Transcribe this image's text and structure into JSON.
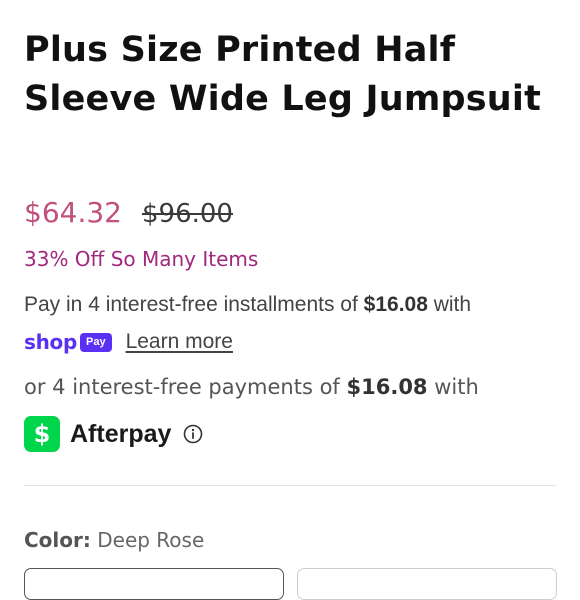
{
  "product": {
    "title": "Plus Size Printed Half Sleeve Wide Leg Jumpsuit",
    "price_sale": "$64.32",
    "price_compare": "$96.00",
    "promo": "33% Off So Many Items"
  },
  "shop_pay": {
    "prefix": "Pay in 4 interest-free installments of ",
    "amount": "$16.08",
    "suffix": " with",
    "logo_word": "shop",
    "logo_badge": "Pay",
    "learn_more": "Learn more"
  },
  "afterpay": {
    "prefix": "or 4 interest-free payments of ",
    "amount": "$16.08",
    "suffix": " with",
    "icon_symbol": "$",
    "name": "Afterpay"
  },
  "options": {
    "color_label": "Color:",
    "color_value": "Deep Rose"
  },
  "colors": {
    "sale_price": "#c2507d",
    "promo_text": "#a0287e",
    "shop_pay_brand": "#5a31f4",
    "cash_app_green": "#00d54b"
  }
}
